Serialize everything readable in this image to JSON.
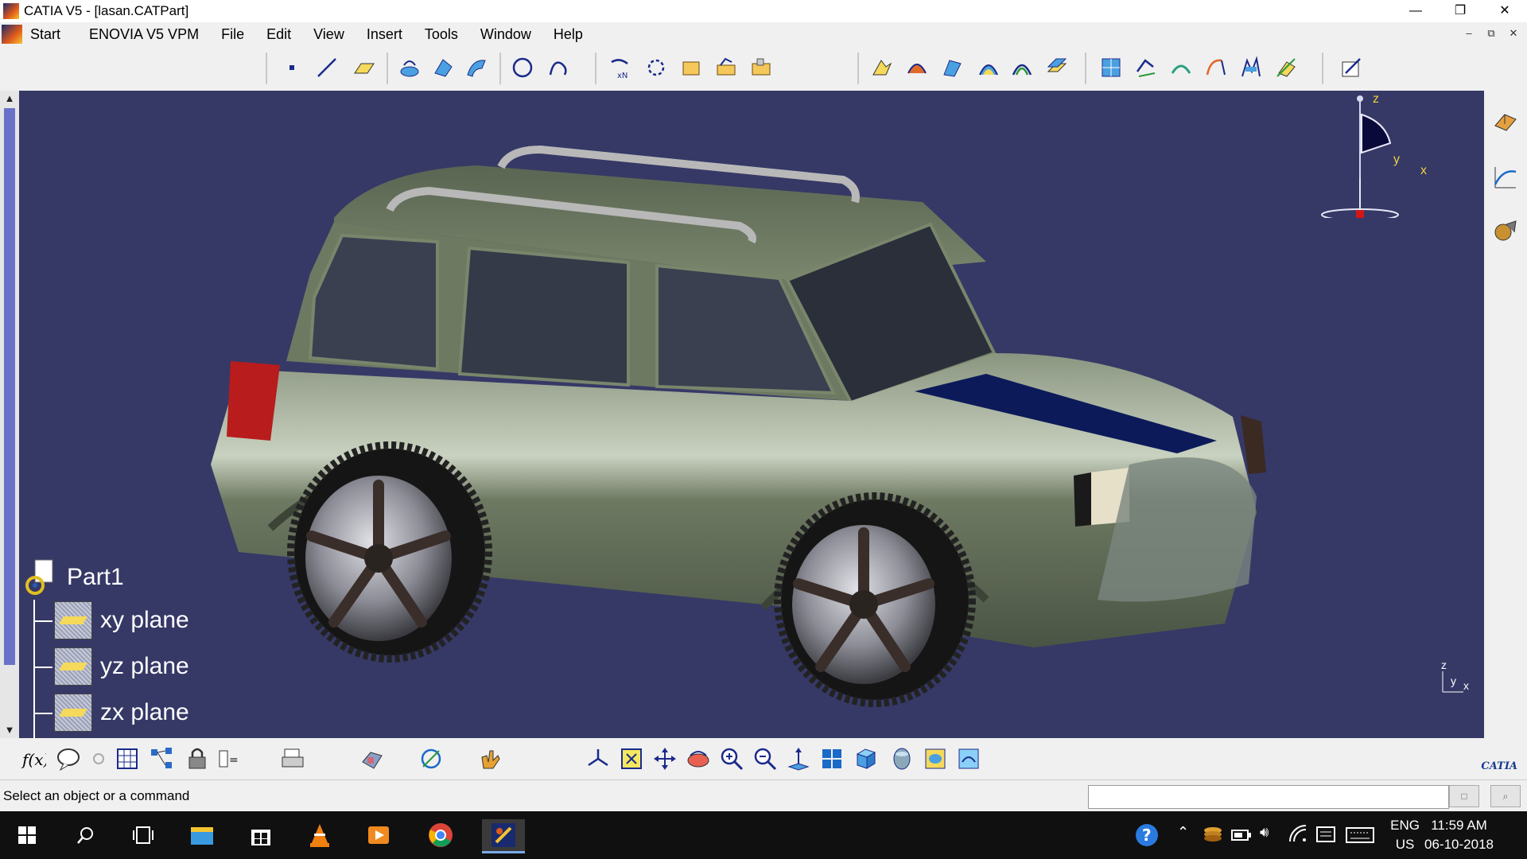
{
  "window": {
    "title": "CATIA V5 - [lasan.CATPart]",
    "controls": [
      "—",
      "❐",
      "✕"
    ]
  },
  "menu": {
    "items": [
      "Start",
      "ENOVIA V5 VPM",
      "File",
      "Edit",
      "View",
      "Insert",
      "Tools",
      "Window",
      "Help"
    ],
    "mdi_controls": [
      "–",
      "⧉",
      "✕"
    ]
  },
  "toolbar_top": {
    "icons": [
      "point-icon",
      "line-icon",
      "plane-icon",
      "extrude-icon",
      "revolve-icon",
      "sweep-icon",
      "circle-icon",
      "spline-icon",
      "repetition-icon",
      "intersection-icon",
      "boundary-icon",
      "join-icon",
      "healing-icon",
      "fill-icon",
      "blend-icon",
      "split-icon",
      "trim-icon",
      "offset-icon",
      "translate-icon",
      "axis-system-icon",
      "sketch-icon",
      "curve-icon",
      "connect-curve-icon",
      "projection-icon",
      "reflect-line-icon",
      "sketcher-icon"
    ]
  },
  "tree": {
    "root": "Part1",
    "items": [
      "xy plane",
      "yz plane",
      "zx plane"
    ]
  },
  "compass": {
    "z": "z",
    "x": "x",
    "y": "y"
  },
  "axis_mini": {
    "z": "z",
    "y": "y",
    "x": "x"
  },
  "toolbar_bottom": {
    "icons": [
      "formula-icon",
      "annotation-icon",
      "knowledge-icon",
      "table-icon",
      "catalog-icon",
      "lock-icon",
      "measure-icon",
      "print-icon",
      "apply-material-icon",
      "sketch-analysis-icon",
      "hand-icon",
      "fly-mode-icon",
      "fit-all-icon",
      "pan-icon",
      "rotate-icon",
      "zoom-in-icon",
      "zoom-out-icon",
      "normal-view-icon",
      "multi-view-icon",
      "iso-view-icon",
      "shading-icon",
      "hide-show-icon",
      "swap-space-icon"
    ],
    "brand": "CATIA"
  },
  "status": {
    "message": "Select an object or a command",
    "command_placeholder": ""
  },
  "taskbar": {
    "apps": [
      "start-button",
      "search-icon",
      "task-view-icon",
      "file-explorer-icon",
      "store-icon",
      "vlc-icon",
      "media-player-icon",
      "chrome-icon",
      "catia-icon"
    ],
    "language": "ENG",
    "region": "US",
    "time": "11:59 AM",
    "date": "06-10-2018"
  },
  "colors": {
    "viewport_bg": "#363966",
    "car_body": "#6e7962",
    "taillight": "#b81c1c",
    "hood_stripe": "#0c1a5a",
    "tree_text": "#ffffff"
  }
}
